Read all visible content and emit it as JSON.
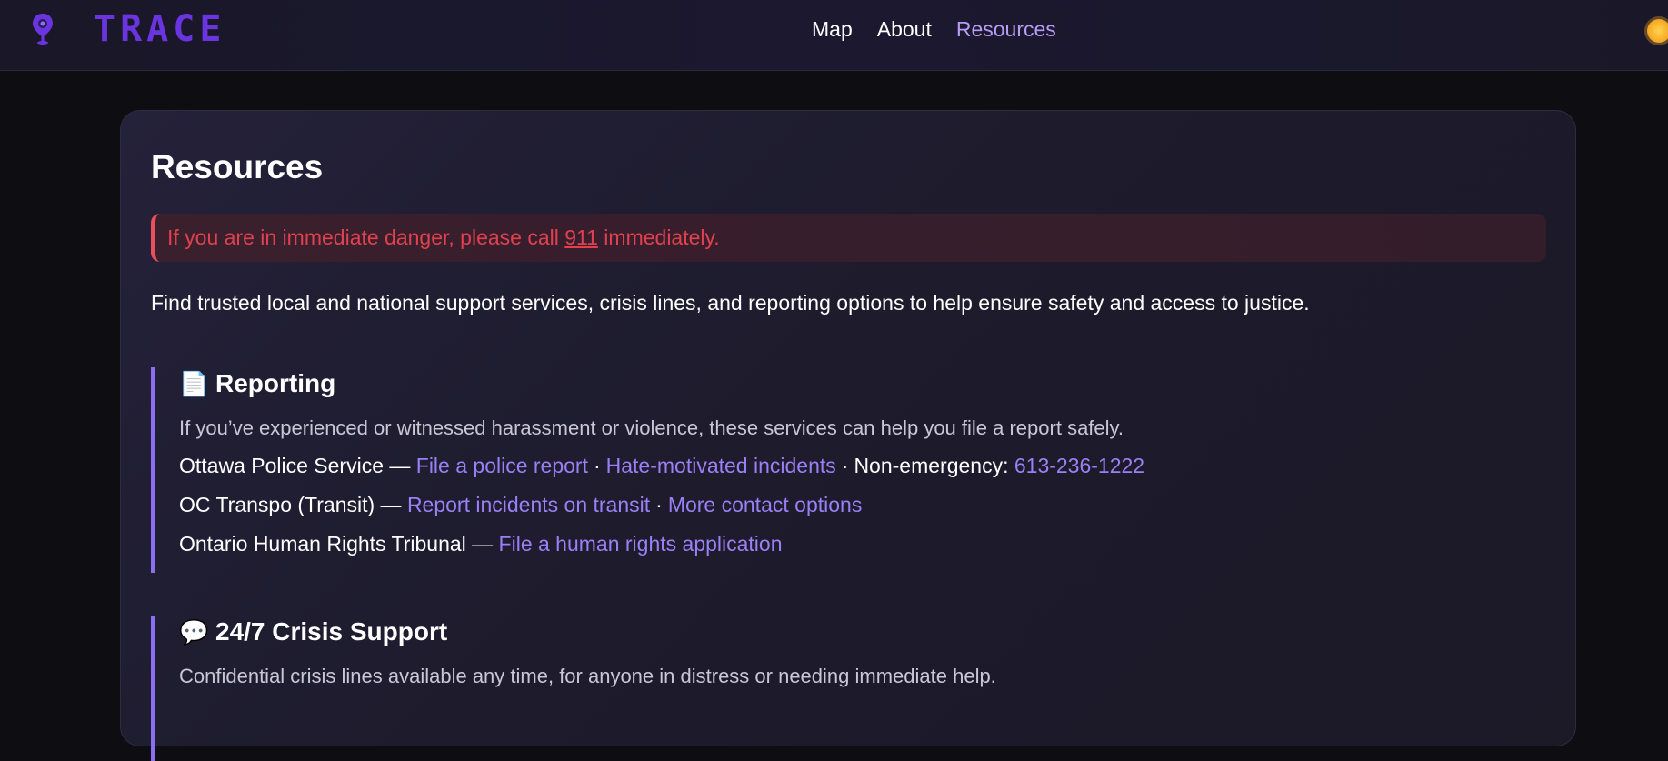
{
  "header": {
    "logo_text": "TRACE",
    "nav": [
      "Map",
      "About",
      "Resources"
    ],
    "active_nav": "Resources",
    "theme_icon": "sun-icon"
  },
  "page": {
    "title": "Resources",
    "alert": {
      "before": "If you are in immediate danger, please call ",
      "number": "911",
      "after": " immediately."
    },
    "intro": "Find trusted local and national support services, crisis lines, and reporting options to help ensure safety and access to justice."
  },
  "sections": [
    {
      "icon": "📄",
      "icon_name": "document-icon",
      "title": "Reporting",
      "description": "If you’ve experienced or witnessed harassment or violence, these services can help you file a report safely.",
      "rows": [
        {
          "name": "Ottawa Police Service",
          "links": [
            "File a police report",
            "Hate-motivated incidents"
          ],
          "extra_label": "Non-emergency:",
          "extra_link": "613-236-1222"
        },
        {
          "name": "OC Transpo (Transit)",
          "links": [
            "Report incidents on transit",
            "More contact options"
          ]
        },
        {
          "name": "Ontario Human Rights Tribunal",
          "links": [
            "File a human rights application"
          ]
        }
      ]
    },
    {
      "icon": "💬",
      "icon_name": "speech-bubble-icon",
      "title": "24/7 Crisis Support",
      "description": "Confidential crisis lines available any time, for anyone in distress or needing immediate help."
    }
  ],
  "colors": {
    "accent": "#8a6ff2",
    "link": "#9a80f5",
    "alert": "#e0414f",
    "logo": "#6a35e0"
  }
}
